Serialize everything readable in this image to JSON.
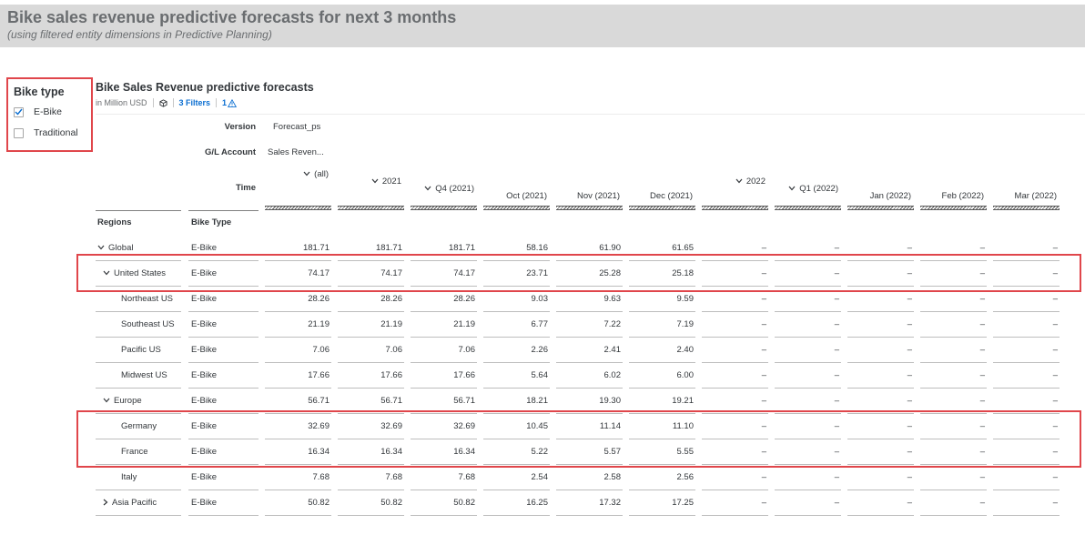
{
  "header": {
    "title": "Bike sales revenue predictive forecasts for next 3 months",
    "subtitle": "(using filtered entity dimensions in Predictive Planning)"
  },
  "filter": {
    "title": "Bike type",
    "options": [
      {
        "label": "E-Bike",
        "checked": true
      },
      {
        "label": "Traditional",
        "checked": false
      }
    ]
  },
  "widget": {
    "title": "Bike Sales Revenue predictive forecasts",
    "unit": "in Million USD",
    "filters_link": "3 Filters",
    "warning_count": "1"
  },
  "table": {
    "version_label": "Version",
    "version_value": "Forecast_ps",
    "account_label": "G/L Account",
    "account_value": "Sales Reven...",
    "time_label": "Time",
    "row_headers": [
      "Regions",
      "Bike Type"
    ],
    "columns": [
      "(all)",
      "2021",
      "Q4 (2021)",
      "Oct (2021)",
      "Nov (2021)",
      "Dec (2021)",
      "2022",
      "Q1 (2022)",
      "Jan (2022)",
      "Feb (2022)",
      "Mar (2022)"
    ],
    "rows": [
      {
        "region": "Global",
        "bike": "E-Bike",
        "values": [
          "181.71",
          "181.71",
          "181.71",
          "58.16",
          "61.90",
          "61.65",
          "–",
          "–",
          "–",
          "–",
          "–"
        ]
      },
      {
        "region": "United States",
        "bike": "E-Bike",
        "values": [
          "74.17",
          "74.17",
          "74.17",
          "23.71",
          "25.28",
          "25.18",
          "–",
          "–",
          "–",
          "–",
          "–"
        ]
      },
      {
        "region": "Northeast US",
        "bike": "E-Bike",
        "values": [
          "28.26",
          "28.26",
          "28.26",
          "9.03",
          "9.63",
          "9.59",
          "–",
          "–",
          "–",
          "–",
          "–"
        ]
      },
      {
        "region": "Southeast US",
        "bike": "E-Bike",
        "values": [
          "21.19",
          "21.19",
          "21.19",
          "6.77",
          "7.22",
          "7.19",
          "–",
          "–",
          "–",
          "–",
          "–"
        ]
      },
      {
        "region": "Pacific US",
        "bike": "E-Bike",
        "values": [
          "7.06",
          "7.06",
          "7.06",
          "2.26",
          "2.41",
          "2.40",
          "–",
          "–",
          "–",
          "–",
          "–"
        ]
      },
      {
        "region": "Midwest US",
        "bike": "E-Bike",
        "values": [
          "17.66",
          "17.66",
          "17.66",
          "5.64",
          "6.02",
          "6.00",
          "–",
          "–",
          "–",
          "–",
          "–"
        ]
      },
      {
        "region": "Europe",
        "bike": "E-Bike",
        "values": [
          "56.71",
          "56.71",
          "56.71",
          "18.21",
          "19.30",
          "19.21",
          "–",
          "–",
          "–",
          "–",
          "–"
        ]
      },
      {
        "region": "Germany",
        "bike": "E-Bike",
        "values": [
          "32.69",
          "32.69",
          "32.69",
          "10.45",
          "11.14",
          "11.10",
          "–",
          "–",
          "–",
          "–",
          "–"
        ]
      },
      {
        "region": "France",
        "bike": "E-Bike",
        "values": [
          "16.34",
          "16.34",
          "16.34",
          "5.22",
          "5.57",
          "5.55",
          "–",
          "–",
          "–",
          "–",
          "–"
        ]
      },
      {
        "region": "Italy",
        "bike": "E-Bike",
        "values": [
          "7.68",
          "7.68",
          "7.68",
          "2.54",
          "2.58",
          "2.56",
          "–",
          "–",
          "–",
          "–",
          "–"
        ]
      },
      {
        "region": "Asia Pacific",
        "bike": "E-Bike",
        "values": [
          "50.82",
          "50.82",
          "50.82",
          "16.25",
          "17.32",
          "17.25",
          "–",
          "–",
          "–",
          "–",
          "–"
        ]
      }
    ]
  }
}
